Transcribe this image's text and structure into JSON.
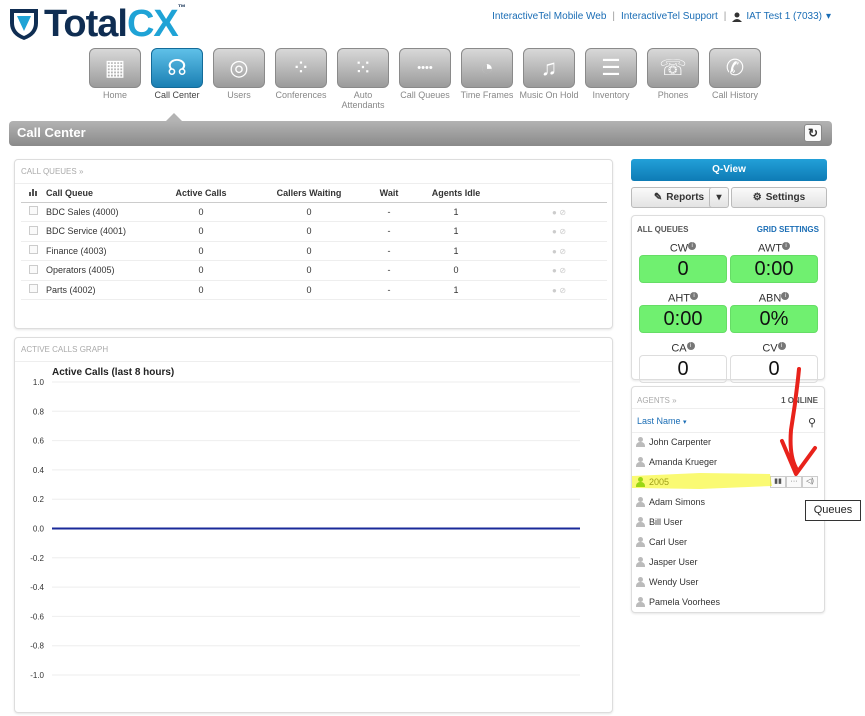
{
  "header": {
    "logo_part1": "Total",
    "logo_part2": "CX",
    "logo_tm": "™",
    "links": [
      "InteractiveTel Mobile Web",
      "InteractiveTel Support"
    ],
    "user": "IAT Test 1 (7033)"
  },
  "nav": [
    {
      "label": "Home",
      "icon": "building-icon",
      "glyph": "▦"
    },
    {
      "label": "Call Center",
      "icon": "headset-icon",
      "glyph": "☊",
      "active": true
    },
    {
      "label": "Users",
      "icon": "users-icon",
      "glyph": "◎"
    },
    {
      "label": "Conferences",
      "icon": "conference-icon",
      "glyph": "⁘"
    },
    {
      "label": "Auto Attendants",
      "icon": "keypad-icon",
      "glyph": "⁙"
    },
    {
      "label": "Call Queues",
      "icon": "queue-icon",
      "glyph": "••••"
    },
    {
      "label": "Time Frames",
      "icon": "clock-icon",
      "glyph": "◔"
    },
    {
      "label": "Music On Hold",
      "icon": "music-icon",
      "glyph": "♫"
    },
    {
      "label": "Inventory",
      "icon": "list-icon",
      "glyph": "☰"
    },
    {
      "label": "Phones",
      "icon": "phone-icon",
      "glyph": "☏"
    },
    {
      "label": "Call History",
      "icon": "call-history-icon",
      "glyph": "✆"
    }
  ],
  "page_title": "Call Center",
  "call_queues": {
    "heading": "CALL QUEUES »",
    "columns": [
      "Call Queue",
      "Active Calls",
      "Callers Waiting",
      "Wait",
      "Agents Idle"
    ],
    "rows": [
      [
        "BDC Sales (4000)",
        "0",
        "0",
        "-",
        "1"
      ],
      [
        "BDC Service (4001)",
        "0",
        "0",
        "-",
        "1"
      ],
      [
        "Finance (4003)",
        "0",
        "0",
        "-",
        "1"
      ],
      [
        "Operators (4005)",
        "0",
        "0",
        "-",
        "0"
      ],
      [
        "Parts (4002)",
        "0",
        "0",
        "-",
        "1"
      ]
    ]
  },
  "graph": {
    "heading": "ACTIVE CALLS GRAPH"
  },
  "chart_data": {
    "type": "line",
    "title": "Active Calls (last 8 hours)",
    "xlabel": "",
    "ylabel": "",
    "ylim": [
      -1.0,
      1.0
    ],
    "y_ticks": [
      "1.0",
      "0.8",
      "0.6",
      "0.4",
      "0.2",
      "0.0",
      "-0.2",
      "-0.4",
      "-0.6",
      "-0.8",
      "-1.0"
    ],
    "grid": true,
    "series": [
      {
        "values": [
          0,
          0
        ]
      }
    ]
  },
  "right": {
    "qview": "Q-View",
    "reports": "Reports",
    "settings": "Settings",
    "all_queues": "ALL QUEUES",
    "grid_settings": "GRID SETTINGS",
    "stats": [
      {
        "label": "CW",
        "value": "0",
        "green": true
      },
      {
        "label": "AWT",
        "value": "0:00",
        "green": true
      },
      {
        "label": "AHT",
        "value": "0:00",
        "green": true
      },
      {
        "label": "ABN",
        "value": "0%",
        "green": true
      },
      {
        "label": "CA",
        "value": "0",
        "green": false
      },
      {
        "label": "CV",
        "value": "0",
        "green": false
      }
    ],
    "agents_heading": "AGENTS »",
    "online_count": "1 ONLINE",
    "sort": "Last Name",
    "agents": [
      {
        "name": "John Carpenter"
      },
      {
        "name": "Amanda Krueger"
      },
      {
        "name": "2005",
        "online": true
      },
      {
        "name": "Adam Simons"
      },
      {
        "name": "Bill User"
      },
      {
        "name": "Carl User"
      },
      {
        "name": "Jasper User"
      },
      {
        "name": "Wendy User"
      },
      {
        "name": "Pamela Voorhees"
      }
    ],
    "tooltip": "Queues"
  },
  "colors": {
    "accent": "#1a7fb3",
    "green": "#70f070",
    "highlight": "#f5f500",
    "arrow": "#e8221b"
  }
}
